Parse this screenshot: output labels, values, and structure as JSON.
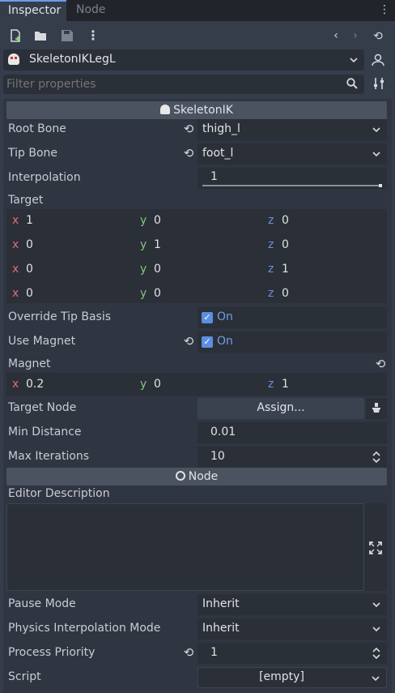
{
  "tabs": [
    {
      "label": "Inspector",
      "active": true
    },
    {
      "label": "Node",
      "active": false
    }
  ],
  "toolbar": {
    "icons": [
      "new-resource-icon",
      "open-folder-icon",
      "save-icon",
      "menu-dots-icon",
      "history-back-icon",
      "history-forward-icon",
      "history-icon"
    ]
  },
  "node_selector": {
    "name": "SkeletonIKLegL"
  },
  "filter": {
    "placeholder": "Filter properties"
  },
  "section_skeletonik": "SkeletonIK",
  "properties": {
    "root_bone": {
      "label": "Root Bone",
      "value": "thigh_l"
    },
    "tip_bone": {
      "label": "Tip Bone",
      "value": "foot_l"
    },
    "interpolation": {
      "label": "Interpolation",
      "value": "1",
      "fraction": 1.0
    },
    "target": {
      "label": "Target",
      "rows": [
        {
          "x": "1",
          "y": "0",
          "z": "0"
        },
        {
          "x": "0",
          "y": "1",
          "z": "0"
        },
        {
          "x": "0",
          "y": "0",
          "z": "1"
        },
        {
          "x": "0",
          "y": "0",
          "z": "0"
        }
      ]
    },
    "override_tip_basis": {
      "label": "Override Tip Basis",
      "value": "On"
    },
    "use_magnet": {
      "label": "Use Magnet",
      "value": "On"
    },
    "magnet": {
      "label": "Magnet",
      "x": "0.2",
      "y": "0",
      "z": "1"
    },
    "target_node": {
      "label": "Target Node",
      "value": "Assign..."
    },
    "min_distance": {
      "label": "Min Distance",
      "value": "0.01"
    },
    "max_iterations": {
      "label": "Max Iterations",
      "value": "10"
    }
  },
  "section_node": "Node",
  "node_props": {
    "editor_description": {
      "label": "Editor Description"
    },
    "pause_mode": {
      "label": "Pause Mode",
      "value": "Inherit"
    },
    "physics_interpolation_mode": {
      "label": "Physics Interpolation Mode",
      "value": "Inherit"
    },
    "process_priority": {
      "label": "Process Priority",
      "value": "1"
    },
    "script": {
      "label": "Script",
      "value": "[empty]"
    }
  },
  "axis_labels": {
    "x": "x",
    "y": "y",
    "z": "z"
  },
  "colors": {
    "accent": "#699ce8",
    "axis_x": "#e06c75",
    "axis_y": "#7fc77a",
    "axis_z": "#6e8fdc"
  }
}
